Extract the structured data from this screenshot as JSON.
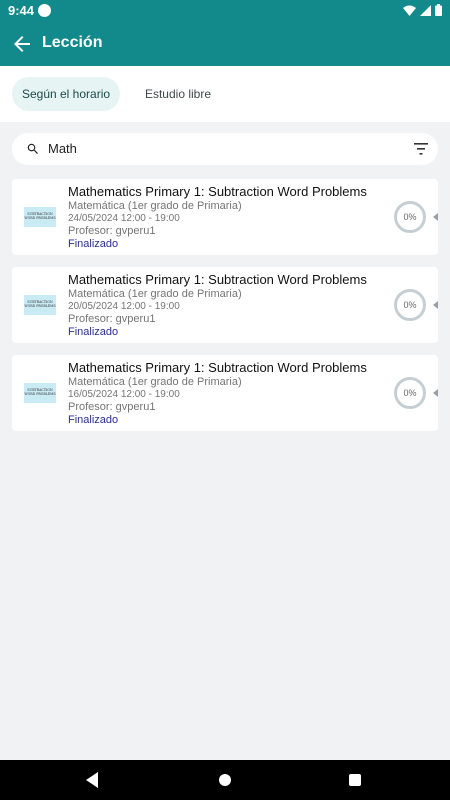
{
  "status_bar": {
    "time": "9:44"
  },
  "app_bar": {
    "title": "Lección"
  },
  "tabs": [
    {
      "label": "Según el horario",
      "active": true
    },
    {
      "label": "Estudio libre",
      "active": false
    }
  ],
  "search": {
    "value": "Math"
  },
  "lessons": [
    {
      "thumbnail_text": "SUBTRACTION WORD PROBLEMS",
      "title": "Mathematics Primary 1: Subtraction Word Problems",
      "subject": "Matemática (1er grado de Primaria)",
      "date": "24/05/2024 12:00 - 19:00",
      "teacher": "Profesor: gvperu1",
      "status": "Finalizado",
      "progress": "0%"
    },
    {
      "thumbnail_text": "SUBTRACTION WORD PROBLEMS",
      "title": "Mathematics Primary 1: Subtraction Word Problems",
      "subject": "Matemática (1er grado de Primaria)",
      "date": "20/05/2024 12:00 - 19:00",
      "teacher": "Profesor: gvperu1",
      "status": "Finalizado",
      "progress": "0%"
    },
    {
      "thumbnail_text": "SUBTRACTION WORD PROBLEMS",
      "title": "Mathematics Primary 1: Subtraction Word Problems",
      "subject": "Matemática (1er grado de Primaria)",
      "date": "16/05/2024 12:00 - 19:00",
      "teacher": "Profesor: gvperu1",
      "status": "Finalizado",
      "progress": "0%"
    }
  ],
  "colors": {
    "primary": "#12898b",
    "status_text": "#2a2f8f",
    "background": "#f1f2f4"
  }
}
